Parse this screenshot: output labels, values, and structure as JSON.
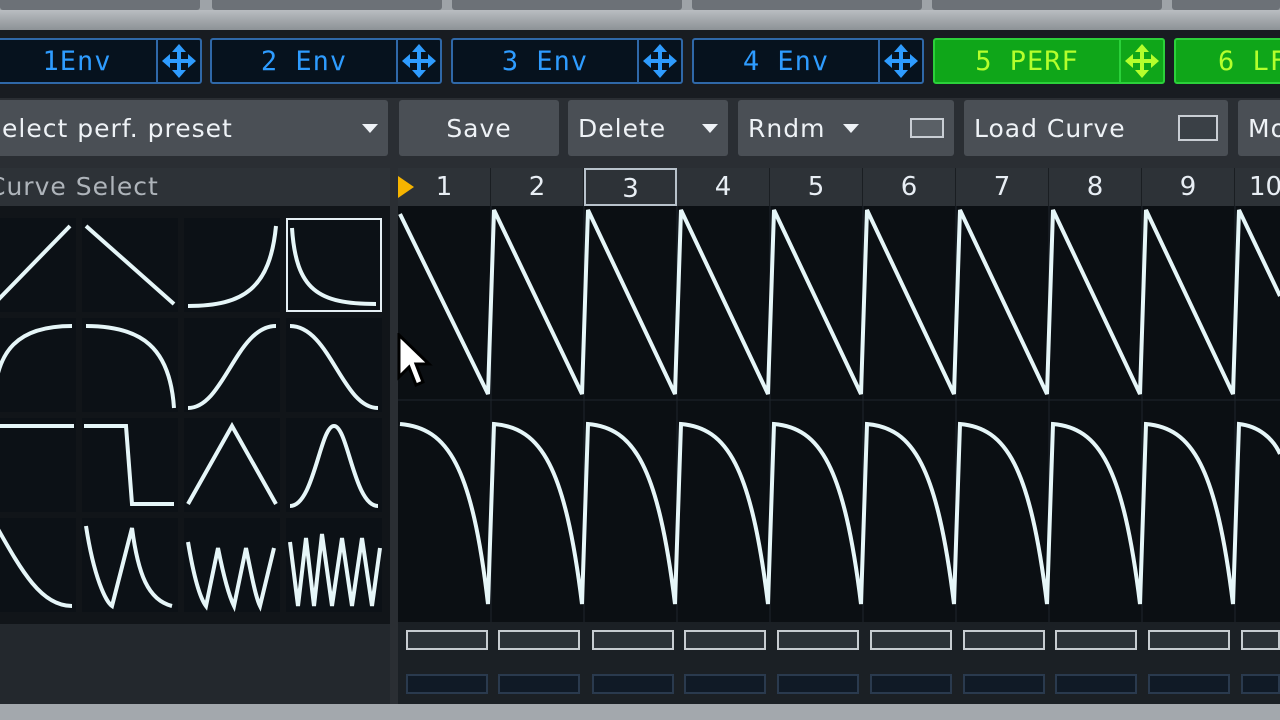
{
  "env_tabs": [
    {
      "label": "1Env",
      "active": false
    },
    {
      "label": "2 Env",
      "active": false
    },
    {
      "label": "3 Env",
      "active": false
    },
    {
      "label": "4 Env",
      "active": false
    },
    {
      "label": "5 PERF",
      "active": true
    },
    {
      "label": "6 LF",
      "active": false
    }
  ],
  "toolbar": {
    "preset_select": "elect perf. preset",
    "save": "Save",
    "delete": "Delete",
    "rndm": "Rndm",
    "load_curve": "Load Curve",
    "more": "Mo"
  },
  "curve_panel": {
    "title": "Curve Select",
    "curves": [
      "ramp-up",
      "ramp-down",
      "exp-up",
      "exp-down",
      "log-up",
      "log-down",
      "s-up",
      "s-down",
      "pulse",
      "step-down",
      "triangle",
      "bell",
      "log-down-short",
      "multi-decay-2",
      "multi-saw-3",
      "multi-saw-5"
    ],
    "selected_index": 3
  },
  "steps": {
    "numbers": [
      "1",
      "2",
      "3",
      "4",
      "5",
      "6",
      "7",
      "8",
      "9",
      "10"
    ],
    "current_index": 2
  },
  "colors": {
    "env_blue": "#2e9cff",
    "perf_green": "#0fa619",
    "play_marker": "#f6b400",
    "curve_stroke": "#e6f6f8"
  }
}
